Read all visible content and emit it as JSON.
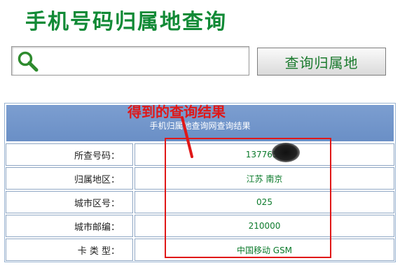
{
  "page": {
    "title": "手机号码归属地查询"
  },
  "search": {
    "placeholder": "",
    "value": "",
    "button_label": "查询归属地"
  },
  "result": {
    "header_text": "手机归属地查询网查询结果",
    "rows": [
      {
        "label": "所查号码：",
        "value": "1377651"
      },
      {
        "label": "归属地区：",
        "value": "江苏 南京"
      },
      {
        "label": "城市区号：",
        "value": "025"
      },
      {
        "label": "城市邮编：",
        "value": "210000"
      },
      {
        "label": "卡 类 型：",
        "value": "中国移动 GSM"
      }
    ]
  },
  "annotation": {
    "text": "得到的查询结果"
  },
  "colors": {
    "title_green": "#118a36",
    "header_blue": "#6a8fc6",
    "value_green": "#0b7a2b",
    "annotation_red": "#e01818"
  },
  "icons": {
    "search": "magnifier-icon"
  }
}
